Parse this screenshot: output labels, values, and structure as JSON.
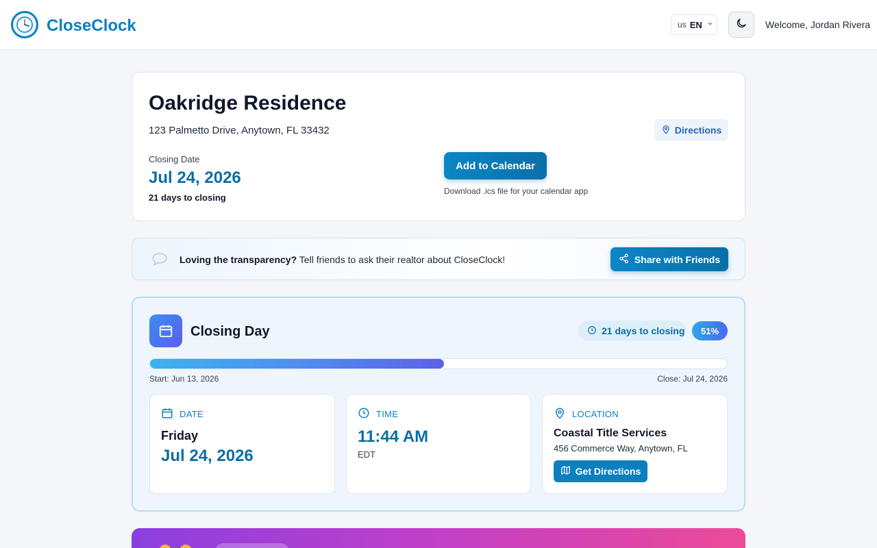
{
  "header": {
    "brand": "CloseClock",
    "lang_flag": "us",
    "lang_code": "EN",
    "welcome": "Welcome, Jordan Rivera"
  },
  "property": {
    "title": "Oakridge Residence",
    "address": "123 Palmetto Drive, Anytown, FL 33432",
    "directions_label": "Directions",
    "closing_date_label": "Closing Date",
    "closing_date": "Jul 24, 2026",
    "days_to_closing": "21 days to closing",
    "add_calendar_label": "Add to Calendar",
    "calendar_note": "Download .ics file for your calendar app"
  },
  "share": {
    "bold": "Loving the transparency?",
    "text": " Tell friends to ask their realtor about CloseClock!",
    "button": "Share with Friends"
  },
  "closing_day": {
    "title": "Closing Day",
    "days_pill": "21 days to closing",
    "percent_label": "51%",
    "progress_fraction": 0.51,
    "start_label": "Start: Jun 13, 2026",
    "close_label": "Close: Jul 24, 2026",
    "date": {
      "heading": "DATE",
      "day_of_week": "Friday",
      "value": "Jul 24, 2026"
    },
    "time": {
      "heading": "TIME",
      "value": "11:44 AM",
      "timezone": "EDT"
    },
    "location": {
      "heading": "LOCATION",
      "name": "Coastal Title Services",
      "address": "456 Commerce Way, Anytown, FL",
      "button": "Get Directions"
    }
  },
  "colors": {
    "brand": "#0b7fc0",
    "accent_date": "#0b6ea3",
    "panel_bg": "#eef5fd",
    "promo_start": "#8b3fe0",
    "promo_end": "#ec4b97"
  },
  "icons": {
    "logo": "clock-logo-icon",
    "theme": "moon-icon",
    "directions": "map-pin-icon",
    "share_bubble": "speech-bubble-icon",
    "share": "share-icon",
    "panel": "calendar-icon",
    "days": "clock-icon",
    "date": "calendar-icon",
    "time": "clock-icon",
    "location": "map-pin-icon",
    "get_directions": "map-icon"
  }
}
